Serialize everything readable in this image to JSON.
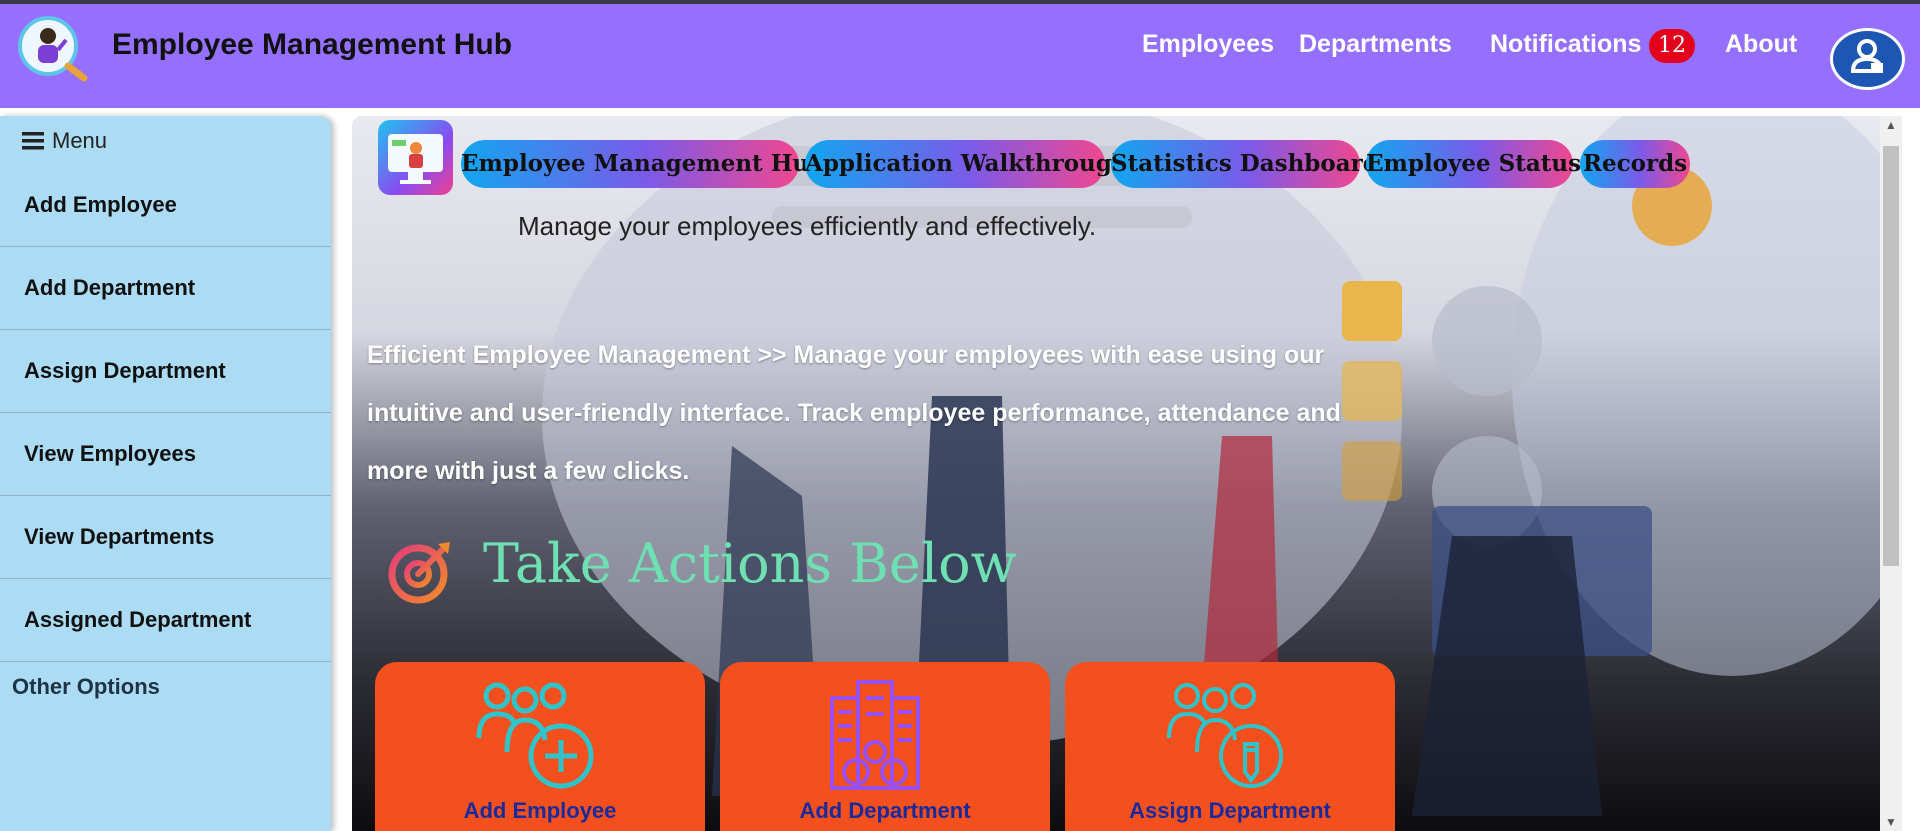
{
  "header": {
    "title": "Employee Management Hub",
    "nav": [
      "Employees",
      "Departments",
      "Notifications",
      "About"
    ],
    "notification_count": "12"
  },
  "sidebar": {
    "menu_label": "Menu",
    "items": [
      {
        "label": "Add Employee"
      },
      {
        "label": "Add Department"
      },
      {
        "label": "Assign Department"
      },
      {
        "label": "View Employees"
      },
      {
        "label": "View Departments"
      },
      {
        "label": "Assigned Department"
      }
    ],
    "other_label": "Other Options"
  },
  "main": {
    "tabs": [
      {
        "label": "Employee Management Hub"
      },
      {
        "label": "Application Walkthrough"
      },
      {
        "label": "Statistics Dashboard"
      },
      {
        "label": "Employee Status"
      },
      {
        "label": "Records"
      }
    ],
    "subtitle": "Manage your employees efficiently and effectively.",
    "intro": "Efficient Employee Management >> Manage your employees with ease using our intuitive and user-friendly interface. Track employee performance, attendance and more with just a few clicks.",
    "section_title": "Take Actions Below",
    "cards": [
      {
        "label": "Add Employee",
        "icon": "add-employee-icon"
      },
      {
        "label": "Add Department",
        "icon": "building-icon"
      },
      {
        "label": "Assign Department",
        "icon": "assign-icon"
      }
    ]
  },
  "colors": {
    "navbar": "#9570ff",
    "sidebar": "#abdcf4",
    "badge": "#e4001c",
    "card": "#f4501e",
    "card_label": "#1a2a9c",
    "section_title": "#6ee0b2"
  }
}
